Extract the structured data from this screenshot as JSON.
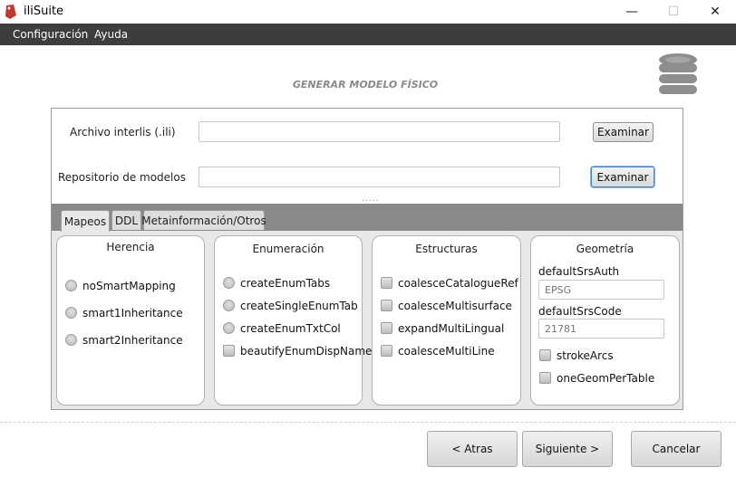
{
  "window": {
    "title": "iliSuite",
    "minimize": "—",
    "maximize": "☐",
    "close": "✕"
  },
  "menu": {
    "items": [
      "Configuración",
      "Ayuda"
    ]
  },
  "heading": "GENERAR MODELO FÍSICO",
  "fields": {
    "archivo_label": "Archivo interlis (.ili)",
    "archivo_value": "",
    "repositorio_label": "Repositorio de modelos",
    "repositorio_value": "",
    "examinar1": "Examinar",
    "examinar2": "Examinar",
    "splitter": "....."
  },
  "tabs": [
    "Mapeos",
    "DDL",
    "Metainformación/Otros"
  ],
  "selected_tab": "Mapeos",
  "herencia": {
    "title": "Herencia",
    "options": [
      "noSmartMapping",
      "smart1Inheritance",
      "smart2Inheritance"
    ]
  },
  "enumeracion": {
    "title": "Enumeración",
    "radios": [
      "createEnumTabs",
      "createSingleEnumTab",
      "createEnumTxtCol"
    ],
    "checkbox": "beautifyEnumDispName"
  },
  "estructuras": {
    "title": "Estructuras",
    "checkboxes": [
      "coalesceCatalogueRef",
      "coalesceMultisurface",
      "expandMultiLingual",
      "coalesceMultiLine"
    ]
  },
  "geometria": {
    "title": "Geometría",
    "auth_label": "defaultSrsAuth",
    "auth_placeholder": "EPSG",
    "code_label": "defaultSrsCode",
    "code_placeholder": "21781",
    "checkboxes": [
      "strokeArcs",
      "oneGeomPerTable"
    ]
  },
  "footer": {
    "back": "< Atras",
    "next": "Siguiente >",
    "cancel": "Cancelar"
  },
  "colors": {
    "menubar": "#3d3d3d",
    "tabheader": "#8a8a8a",
    "heading": "#8a8a8a",
    "focus": "#3a8ad6"
  },
  "icons": {
    "app": "ili-logo-icon",
    "database": "database-icon"
  }
}
